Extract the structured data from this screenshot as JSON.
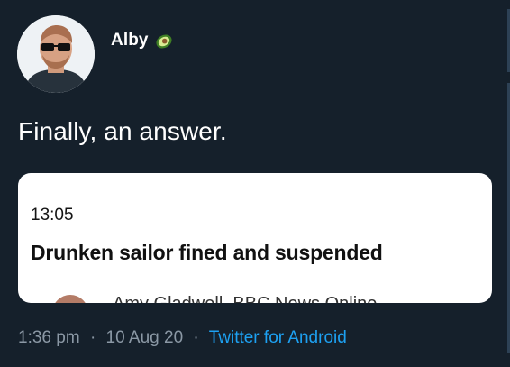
{
  "tweet": {
    "author_name": "Alby",
    "author_badge_icon": "avocado-icon",
    "text": "Finally, an answer.",
    "timestamp_time": "1:36 pm",
    "timestamp_date": "10 Aug 20",
    "separator": "·",
    "source": "Twitter for Android"
  },
  "card": {
    "time": "13:05",
    "headline": "Drunken sailor fined and suspended",
    "byline": "Amy Gladwell, BBC News Online"
  },
  "colors": {
    "background": "#15202b",
    "link": "#1da1f2",
    "muted": "#8b98a5"
  }
}
